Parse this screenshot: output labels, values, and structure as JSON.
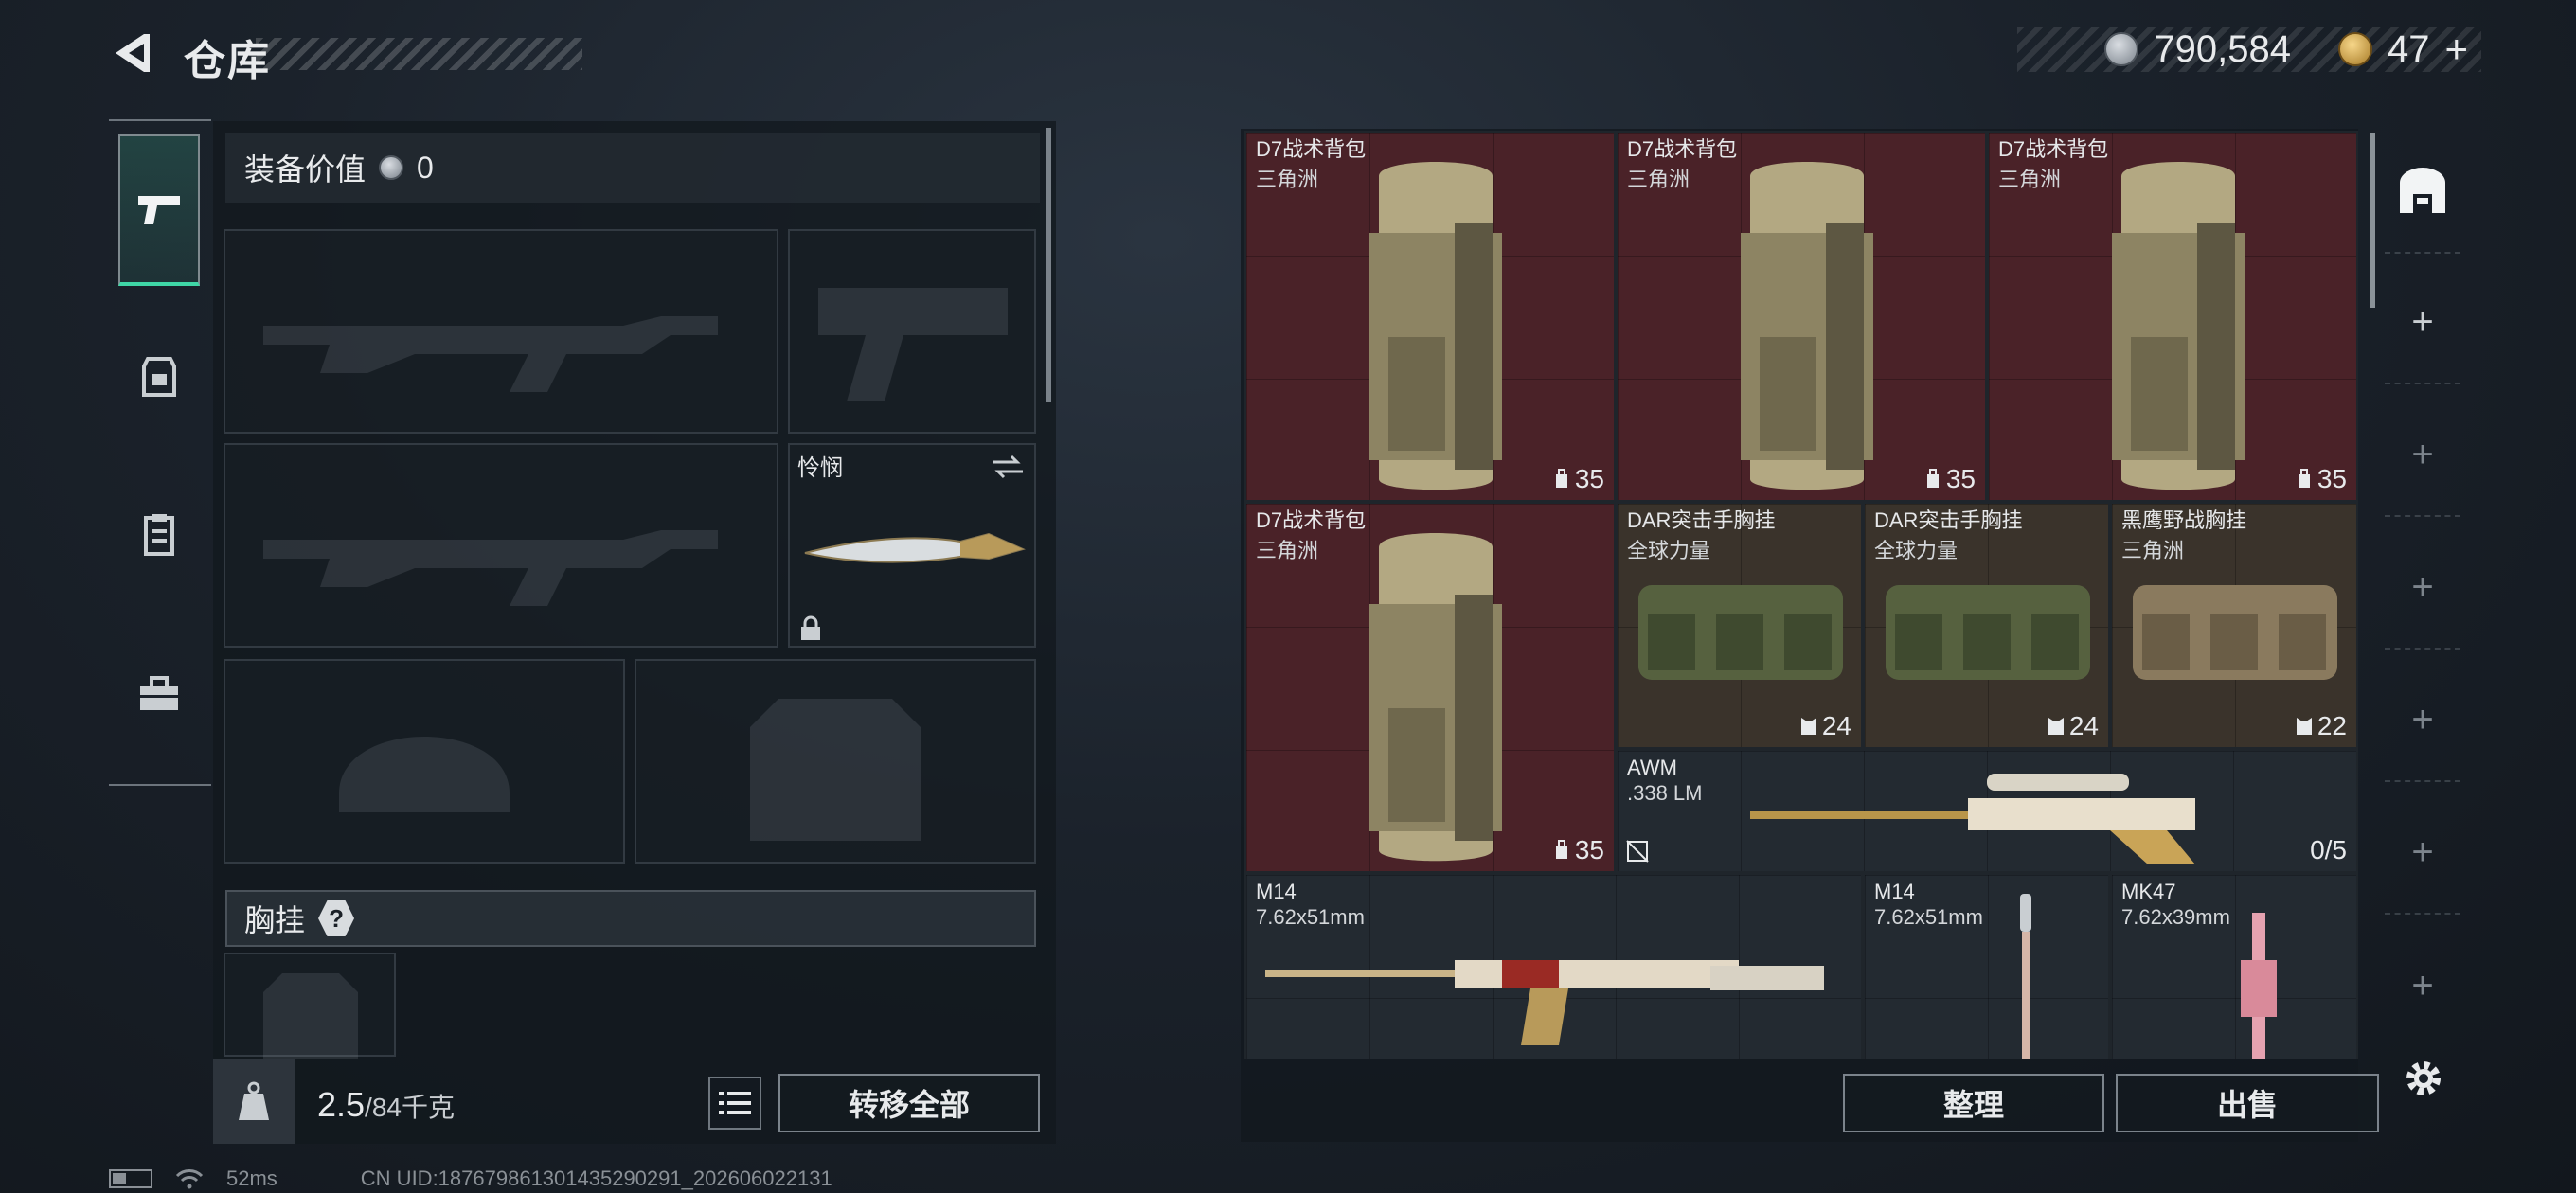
{
  "header": {
    "title": "仓库"
  },
  "currency": {
    "silver": "790,584",
    "gold": "47",
    "plus": "+"
  },
  "equipment": {
    "value_label": "装备价值",
    "value": "0",
    "melee_label": "怜悯",
    "chest_rig_label": "胸挂",
    "help": "?"
  },
  "storage": {
    "items": [
      {
        "name": "D7战术背包",
        "sub": "三角洲",
        "stat": "35"
      },
      {
        "name": "D7战术背包",
        "sub": "三角洲",
        "stat": "35"
      },
      {
        "name": "D7战术背包",
        "sub": "三角洲",
        "stat": "35"
      },
      {
        "name": "D7战术背包",
        "sub": "三角洲",
        "stat": "35"
      },
      {
        "name": "DAR突击手胸挂",
        "sub": "全球力量",
        "stat": "24"
      },
      {
        "name": "DAR突击手胸挂",
        "sub": "全球力量",
        "stat": "24"
      },
      {
        "name": "黑鹰野战胸挂",
        "sub": "三角洲",
        "stat": "22"
      },
      {
        "name": "AWM",
        "sub": ".338 LM",
        "stat": "0/5"
      },
      {
        "name": "M14",
        "sub": "7.62x51mm",
        "stat": ""
      },
      {
        "name": "M14",
        "sub": "7.62x51mm",
        "stat": ""
      },
      {
        "name": "MK47",
        "sub": "7.62x39mm",
        "stat": ""
      }
    ]
  },
  "bottom_bar": {
    "weight": "2.5",
    "capacity": "/84千克",
    "transfer_all": "转移全部",
    "organize": "整理",
    "sell": "出售"
  },
  "footer": {
    "ping": "52ms",
    "uid": "CN UID:187679861301435290291_202606022131"
  },
  "right_rail": {
    "add": "+"
  },
  "colors": {
    "accent": "#3fd6a6",
    "backpack_bg": "#4a2228",
    "rig_bg": "#3a332b"
  }
}
